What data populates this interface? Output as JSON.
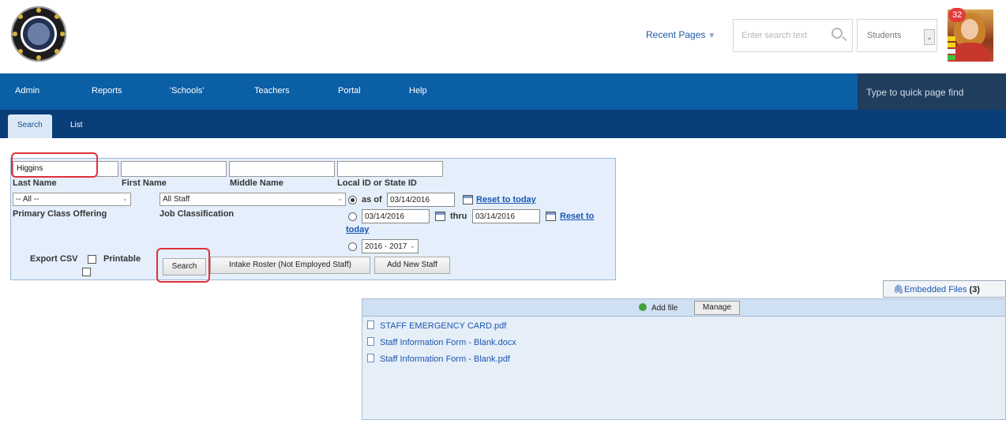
{
  "header": {
    "recent_pages": "Recent Pages",
    "search_placeholder": "Enter search text",
    "scope_select": "Students",
    "notifications": "32"
  },
  "nav": {
    "items": [
      "Admin",
      "Reports",
      "'Schools'",
      "Teachers",
      "Portal",
      "Help"
    ],
    "quick_find": "Type to quick page find"
  },
  "subnav": {
    "tabs": [
      "Search",
      "List"
    ]
  },
  "form": {
    "last_name_value": "Higgins",
    "labels": {
      "last_name": "Last Name",
      "first_name": "First Name",
      "middle_name": "Middle Name",
      "local_id": "Local ID or State ID",
      "primary_class": "Primary Class Offering",
      "job_class": "Job Classification",
      "as_of": "as of",
      "thru": "thru",
      "reset_today": "Reset to today",
      "reset_to": "Reset to",
      "today": "today",
      "export_csv": "Export CSV",
      "printable": "Printable"
    },
    "class_select": "-- All --",
    "job_select": "All Staff",
    "as_of_date": "03/14/2016",
    "range_start": "03/14/2016",
    "range_end": "03/14/2016",
    "year_select": "2016 - 2017",
    "buttons": {
      "search": "Search",
      "intake": "Intake Roster (Not Employed Staff)",
      "add_staff": "Add New Staff"
    }
  },
  "files": {
    "embedded_label": "Embedded Files",
    "embedded_count": "(3)",
    "add_file": "Add file",
    "manage": "Manage",
    "list": [
      "STAFF EMERGENCY CARD.pdf",
      "Staff Information Form - Blank.docx",
      "Staff Information Form - Blank.pdf"
    ]
  }
}
